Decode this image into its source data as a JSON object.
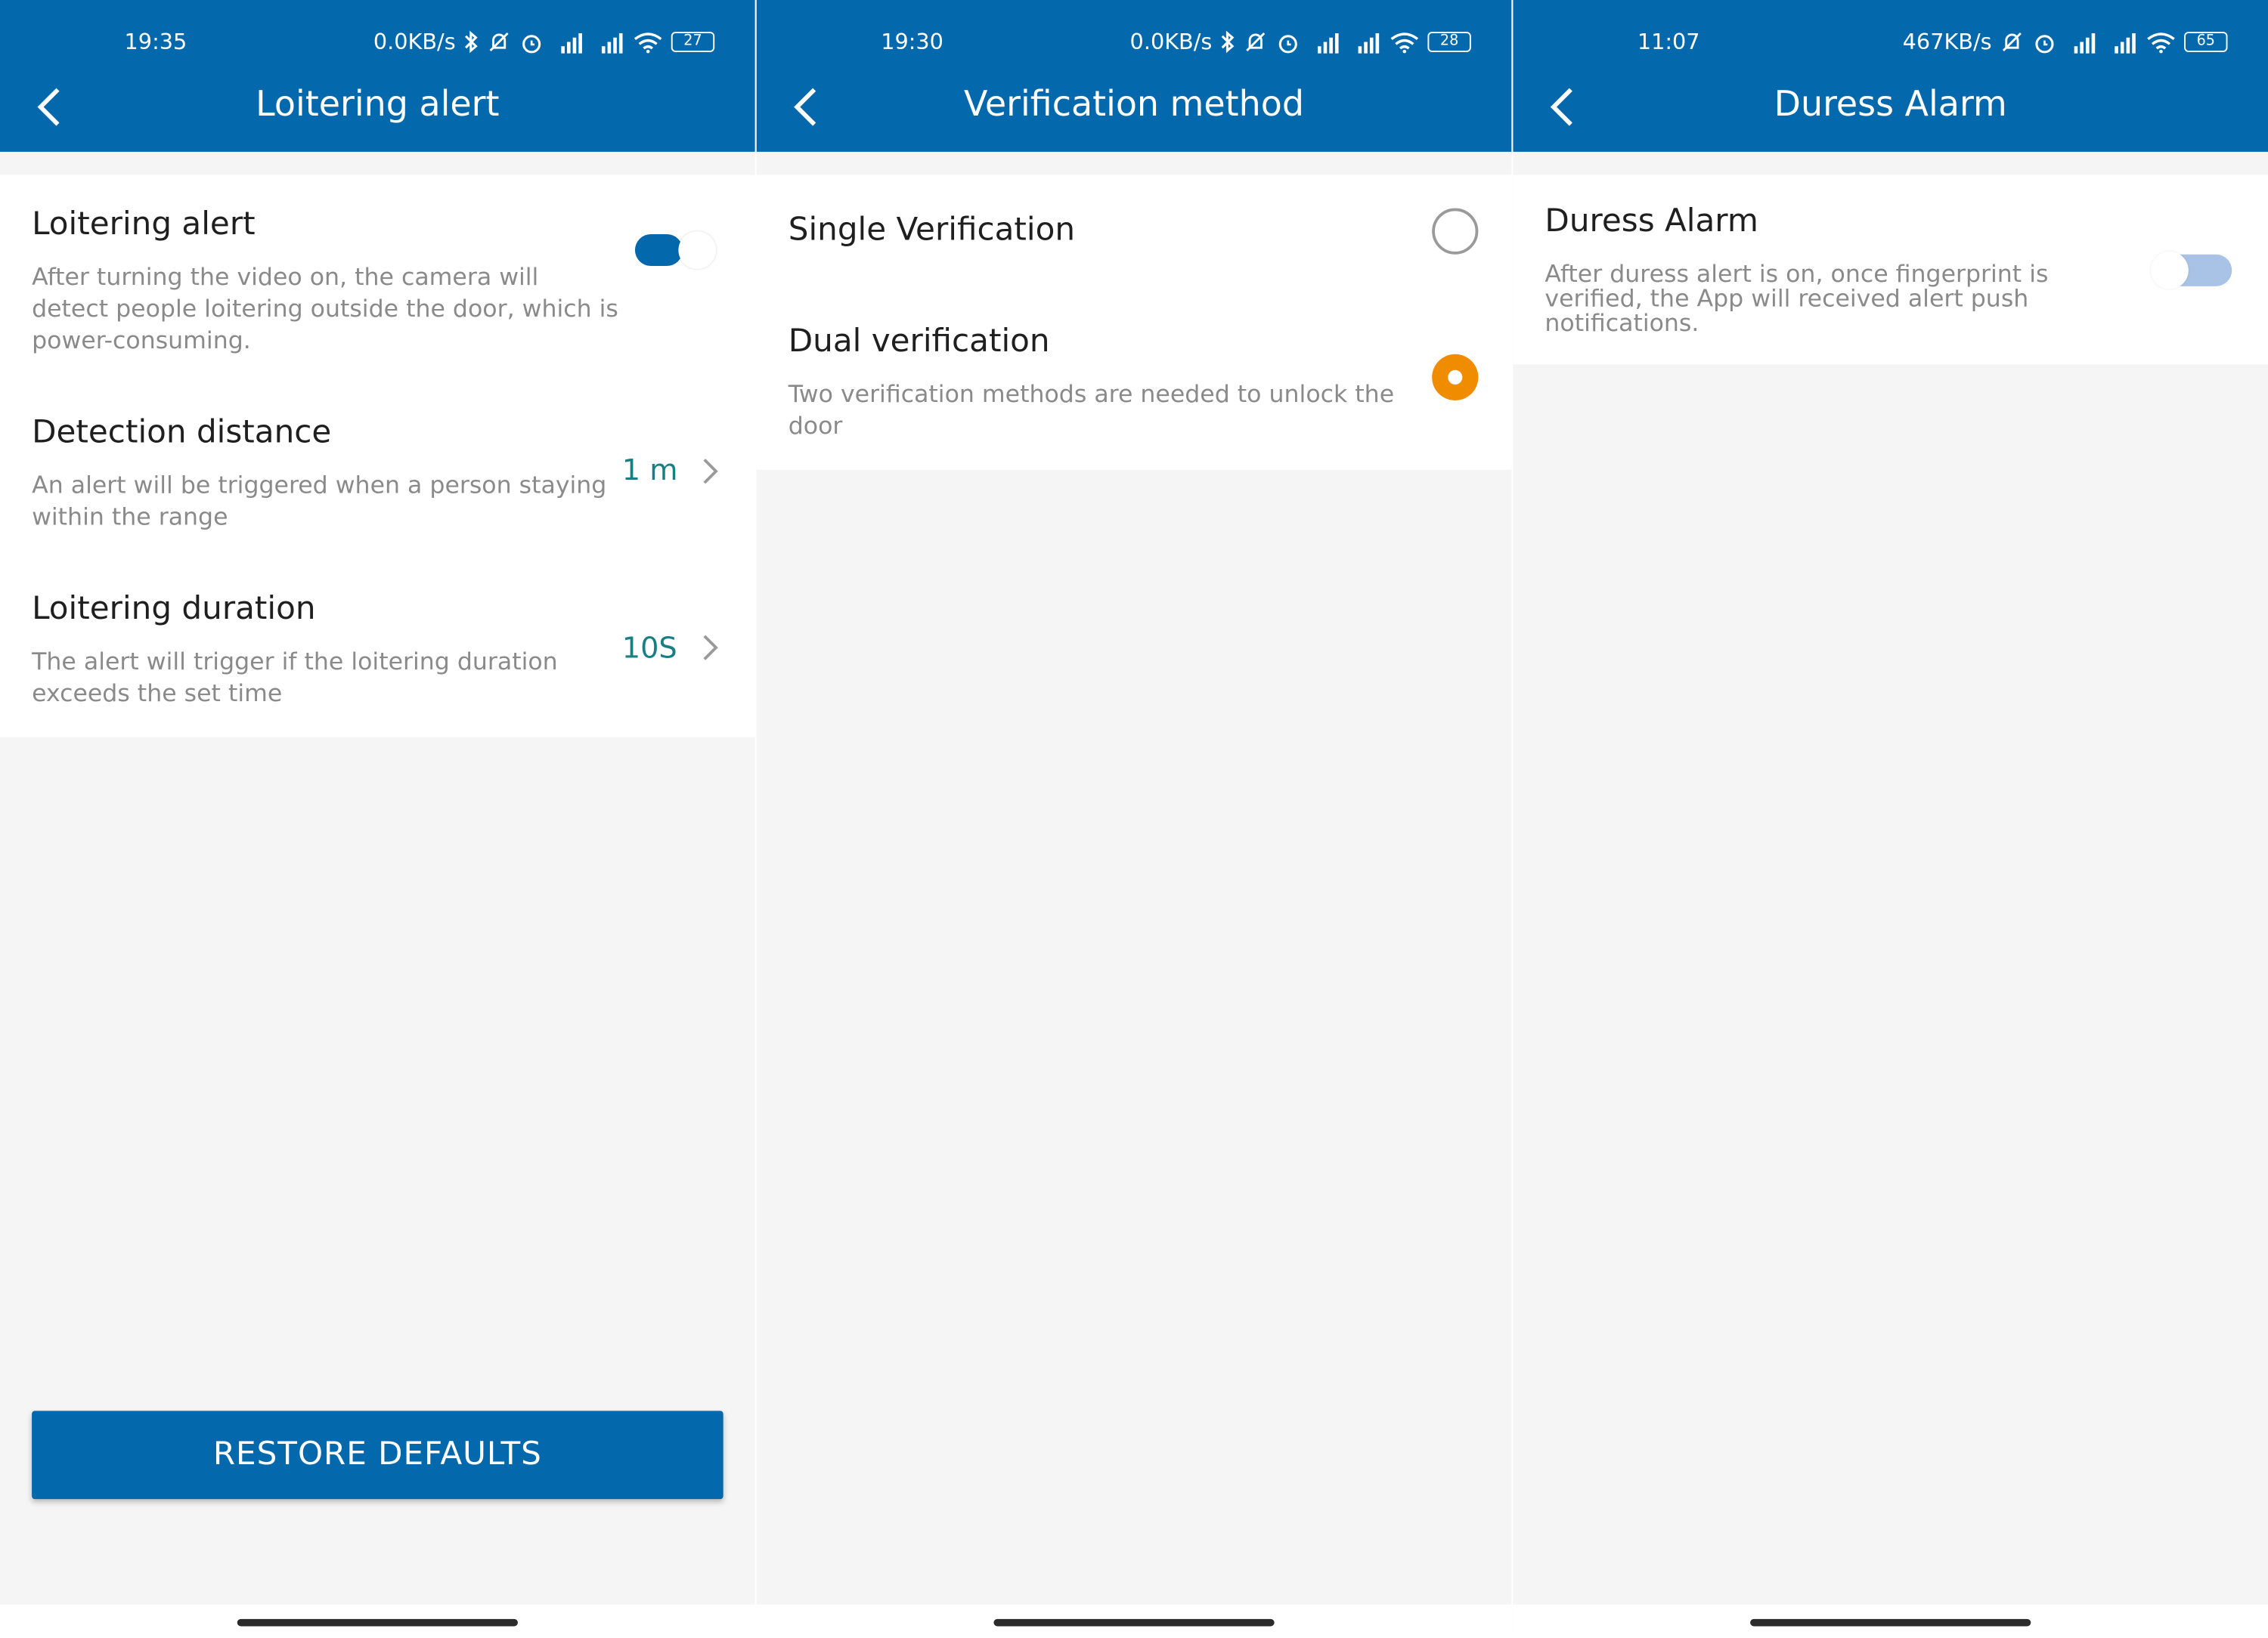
{
  "screens": [
    {
      "status": {
        "time": "19:35",
        "speed": "0.0KB/s",
        "battery": "27"
      },
      "title": "Loitering alert",
      "items": [
        {
          "title": "Loitering alert",
          "desc": [
            "After turning the video on, the camera will",
            "detect people loitering outside the door, which is",
            "power-consuming."
          ],
          "toggle": "on"
        },
        {
          "title": "Detection distance",
          "desc": [
            "An alert will be triggered when a person staying",
            "within the range"
          ],
          "value": "1 m"
        },
        {
          "title": "Loitering duration",
          "desc": [
            "The alert will trigger if the loitering duration",
            "exceeds the set time"
          ],
          "value": "10S"
        }
      ],
      "button": "RESTORE DEFAULTS"
    },
    {
      "status": {
        "time": "19:30",
        "speed": "0.0KB/s",
        "battery": "28"
      },
      "title": "Verification method",
      "items": [
        {
          "title": "Single Verification",
          "selected": false
        },
        {
          "title": "Dual verification",
          "desc": [
            "Two verification methods are needed to unlock the",
            "door"
          ],
          "selected": true
        }
      ]
    },
    {
      "status": {
        "time": "11:07",
        "speed": "467KB/s",
        "battery": "65"
      },
      "title": "Duress Alarm",
      "items": [
        {
          "title": "Duress Alarm",
          "desc": [
            "After duress alert is on, once fingerprint is",
            "verified, the App will received alert push",
            "notifications."
          ],
          "toggle": "disabled"
        }
      ]
    }
  ],
  "colors": {
    "header": "#0468ac",
    "accent_value": "#1a7f84",
    "radio_selected": "#ef8c00",
    "toggle_disabled": "#a9c3e6"
  },
  "icons": [
    "back-arrow-icon",
    "chevron-right-icon",
    "bluetooth-icon",
    "mute-icon",
    "alarm-icon",
    "signal-icon",
    "wifi-icon",
    "battery-icon"
  ]
}
